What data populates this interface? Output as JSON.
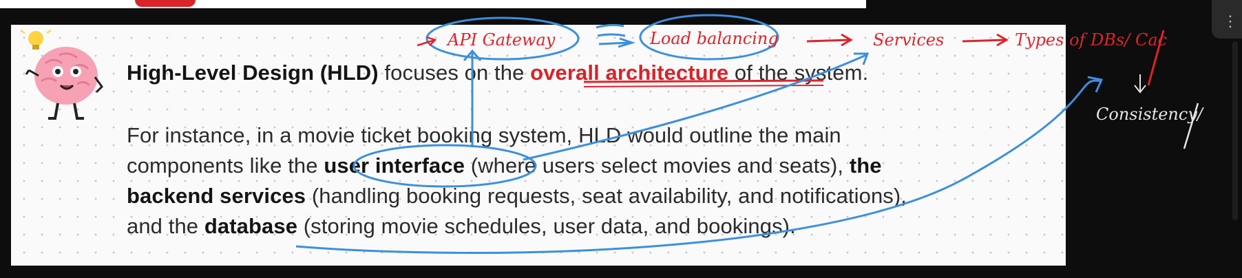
{
  "slide": {
    "line1": {
      "bold_start": "High-Level Design (HLD)",
      "text_mid": " focuses on the ",
      "highlight": "overall architecture",
      "text_end": " of the system."
    },
    "line2": {
      "text": "For instance, in a movie ticket booking system, HLD would outline the main"
    },
    "line3": {
      "text_start": "components like the ",
      "bold1": "user interface",
      "text_mid": " (where users select movies and seats), ",
      "bold2": "the"
    },
    "line4": {
      "bold": "backend services",
      "text": " (handling booking requests, seat availability, and notifications),"
    },
    "line5": {
      "text_start": "and the ",
      "bold": "database",
      "text_end": " (storing movie schedules, user data, and bookings)."
    }
  },
  "annotations": {
    "api_gateway": "API Gateway",
    "load_balancing": "Load balancing",
    "services": "Services",
    "types_of_dbs": "Types of DBs/ Cac",
    "consistency": "Consistency/"
  },
  "colors": {
    "ink_blue": "#3b8fe0",
    "ink_red": "#e0232a",
    "highlight_red": "#d8232a"
  },
  "icons": [
    "lightbulb-icon",
    "brain-mascot"
  ]
}
